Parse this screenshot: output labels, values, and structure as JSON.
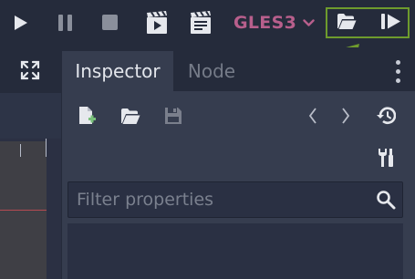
{
  "toolbar": {
    "buttons": [
      "play-icon",
      "pause-icon",
      "stop-icon",
      "play-scene-icon",
      "play-custom-scene-icon"
    ],
    "renderer": {
      "label": "GLES3",
      "icon": "chevron-down-icon"
    },
    "highlighted_buttons": [
      "folder-open-icon",
      "step-forward-icon"
    ],
    "highlight_color": "#6e9b2d",
    "annotation_arrow_color": "#6e9b2d"
  },
  "left_panel": {
    "buttons": [
      "expand-icon"
    ]
  },
  "dock": {
    "tabs": [
      {
        "label": "Inspector",
        "active": true
      },
      {
        "label": "Node",
        "active": false
      }
    ],
    "inspector_toolbar": [
      "new-resource-icon",
      "open-folder-icon",
      "save-icon",
      "history-back-icon",
      "history-forward-icon",
      "history-icon",
      "tools-icon"
    ],
    "filter": {
      "placeholder": "Filter properties",
      "value": "",
      "icon": "search-icon"
    }
  },
  "colors": {
    "background": "#252b3b",
    "panel": "#363d4f",
    "accent_renderer": "#b85f8c",
    "icon": "#e0e3ea"
  }
}
